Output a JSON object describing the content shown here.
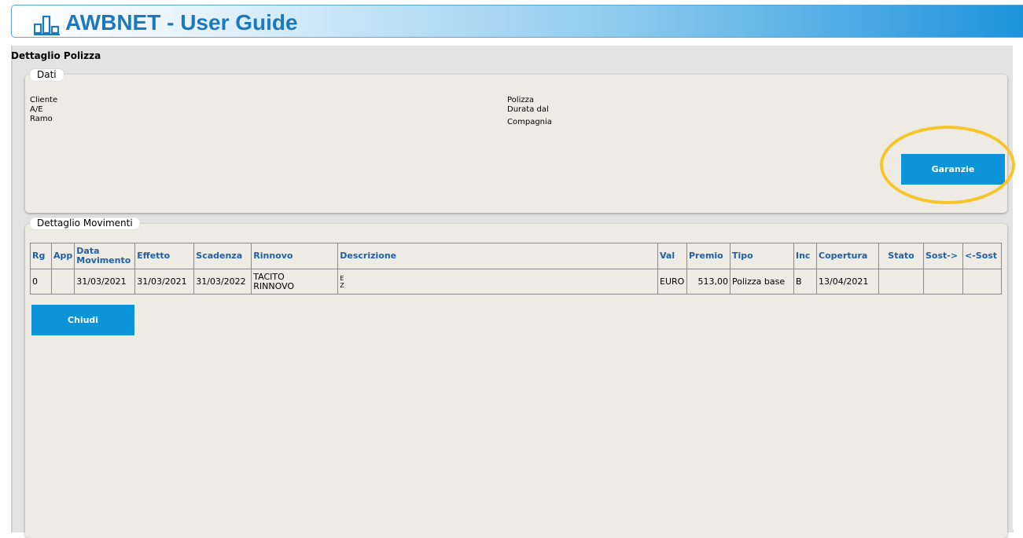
{
  "header": {
    "title": "AWBNET - User Guide",
    "logo_icon": "bar-chart-icon"
  },
  "page": {
    "title": "Dettaglio Polizza"
  },
  "dati": {
    "legend": "Dati",
    "left_labels": [
      "Cliente",
      "A/E",
      "Ramo"
    ],
    "right_labels": [
      "Polizza",
      "Durata dal",
      "Compagnia"
    ],
    "garanzie_label": "Garanzie"
  },
  "movimenti": {
    "legend": "Dettaglio Movimenti",
    "columns": [
      "Rg",
      "App",
      "Data Movimento",
      "Effetto",
      "Scadenza",
      "Rinnovo",
      "Descrizione",
      "Val",
      "Premio",
      "Tipo",
      "Inc",
      "Copertura",
      "Stato",
      "Sost->",
      "<-Sost"
    ],
    "rows": [
      {
        "rg": "0",
        "app": "",
        "data_movimento": "31/03/2021",
        "effetto": "31/03/2021",
        "scadenza": "31/03/2022",
        "rinnovo_line1": "TACITO",
        "rinnovo_line2": "RINNOVO",
        "descrizione_line1": "E",
        "descrizione_line2": "Z",
        "val": "EURO",
        "premio": "513,00",
        "tipo": "Polizza base",
        "inc": "B",
        "copertura": "13/04/2021",
        "stato": "",
        "sost_fwd": "",
        "sost_back": ""
      }
    ]
  },
  "actions": {
    "chiudi_label": "Chiudi"
  },
  "colors": {
    "accent": "#0d94d8",
    "header_text": "#1d79be",
    "highlight": "#f7c528",
    "panel": "#eeebe5"
  }
}
